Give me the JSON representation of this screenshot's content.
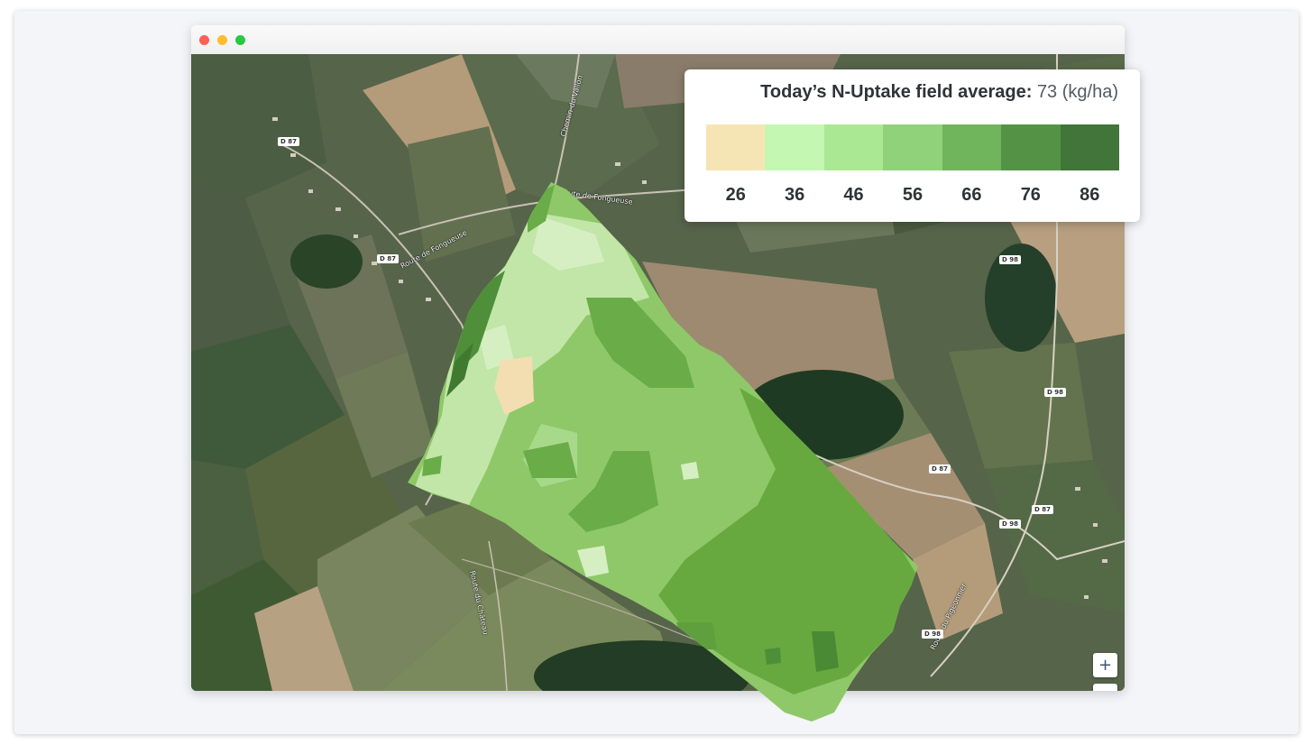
{
  "map": {
    "road_labels": [
      "Chemin-du-Vallon",
      "Route de Fongueuse",
      "Route de Fongueuse",
      "Route du Château",
      "Route du Pigeonnier"
    ],
    "road_badges": [
      "D 87",
      "D 87",
      "D 87",
      "D 87",
      "D 98",
      "D 98",
      "D 98",
      "D 98"
    ],
    "zoom_in_label": "+",
    "zoom_out_label": "−"
  },
  "legend": {
    "title_label": "Today’s N-Uptake field average:",
    "average_value": "73",
    "unit": "(kg/ha)",
    "scale": [
      {
        "value": "26",
        "color": "#f6e5b4"
      },
      {
        "value": "36",
        "color": "#c3f7b2"
      },
      {
        "value": "46",
        "color": "#abe894"
      },
      {
        "value": "56",
        "color": "#8fd27a"
      },
      {
        "value": "66",
        "color": "#70b45c"
      },
      {
        "value": "76",
        "color": "#549346"
      },
      {
        "value": "86",
        "color": "#41753a"
      }
    ]
  }
}
